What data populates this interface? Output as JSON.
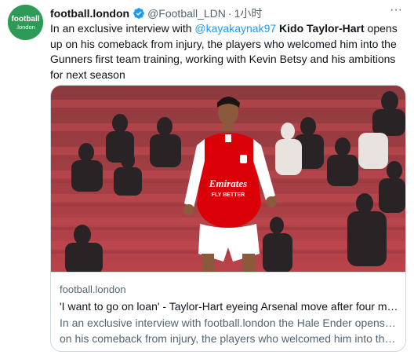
{
  "tweet": {
    "display_name": "football.london",
    "handle": "@Football_LDN",
    "separator": "·",
    "time": "1小时",
    "text_before": "In an exclusive interview with ",
    "mention": "@kayakaynak97",
    "space": " ",
    "strong_name": "Kido Taylor-Hart",
    "text_after": " opens up on his comeback from injury, the players who welcomed him into the Gunners first team training, working with Kevin Betsy and his ambitions for next season"
  },
  "avatar": {
    "logo_top": "football",
    "logo_bottom": ".london"
  },
  "card": {
    "domain": "football.london",
    "title": "'I want to go on loan' - Taylor-Hart eyeing Arsenal move after four months...",
    "desc_line1": "In an exclusive interview with football.london the Hale Ender opens up",
    "desc_line2": "on his comeback from injury, the players who welcomed him into the ...",
    "image": {
      "shirt_sponsor_1": "Emirates",
      "shirt_sponsor_2": "FLY BETTER"
    }
  },
  "colors": {
    "mention": "#1d9bf0",
    "verified": "#1d9bf0",
    "avatar_bg": "#2e9a57",
    "arsenal_red": "#db0007"
  }
}
